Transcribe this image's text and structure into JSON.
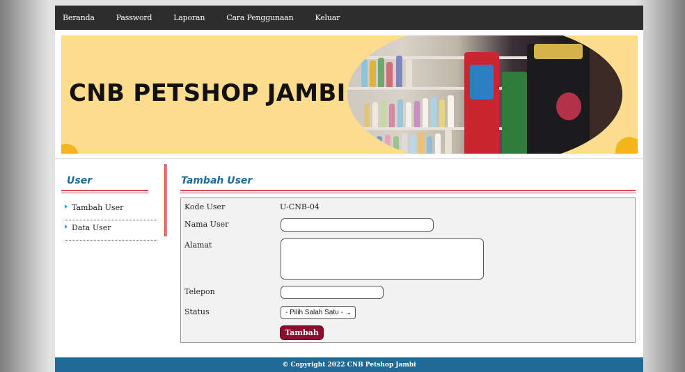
{
  "topnav": {
    "items": [
      "Beranda",
      "Password",
      "Laporan",
      "Cara Penggunaan",
      "Keluar"
    ]
  },
  "banner": {
    "title": "CNB PETSHOP JAMBI"
  },
  "sidebar": {
    "title": "User",
    "items": [
      "Tambah User",
      "Data User"
    ]
  },
  "form": {
    "title": "Tambah User",
    "kode_label": "Kode User",
    "kode_value": "U-CNB-04",
    "nama_label": "Nama User",
    "nama_value": "",
    "alamat_label": "Alamat",
    "alamat_value": "",
    "telepon_label": "Telepon",
    "telepon_value": "",
    "status_label": "Status",
    "status_selected": "- Pilih Salah Satu -",
    "submit_label": "Tambah"
  },
  "footer": {
    "text": "© Copyright 2022 CNB Petshop Jambi"
  },
  "colors": {
    "nav_bg": "#2d2d2d",
    "banner_bg": "#fcdc8e",
    "heading": "#1d6b97",
    "accent_line": "#d74b55",
    "button": "#8b0e2e",
    "footer_bg": "#1f6a96"
  }
}
